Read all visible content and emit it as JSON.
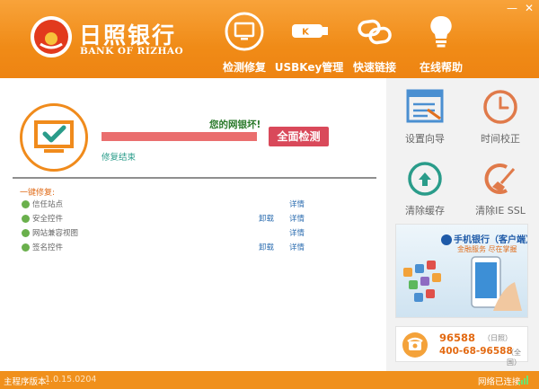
{
  "window": {
    "minimize": "—",
    "close": "✕"
  },
  "brand": {
    "name_cn": "日照银行",
    "name_en": "BANK OF RIZHAO"
  },
  "nav": [
    {
      "label": "检测修复",
      "icon": "monitor-check-icon"
    },
    {
      "label": "USBKey管理",
      "icon": "usbkey-icon"
    },
    {
      "label": "快速链接",
      "icon": "link-icon"
    },
    {
      "label": "在线帮助",
      "icon": "lightbulb-icon"
    }
  ],
  "scan": {
    "status_text": "您的网银坏!",
    "progress": 1.0,
    "button_label": "全面检测",
    "repair_done": "修复结束"
  },
  "repair": {
    "section_title": "一键修复:",
    "items": [
      {
        "label": "信任站点",
        "uninstall": "",
        "detail": "详情"
      },
      {
        "label": "安全控件",
        "uninstall": "卸载",
        "detail": "详情"
      },
      {
        "label": "网站兼容视图",
        "uninstall": "",
        "detail": "详情"
      },
      {
        "label": "签名控件",
        "uninstall": "卸载",
        "detail": "详情"
      }
    ]
  },
  "tools": [
    {
      "label": "设置向导",
      "icon": "settings-wizard-icon"
    },
    {
      "label": "时间校正",
      "icon": "clock-icon"
    },
    {
      "label": "清除缓存",
      "icon": "clear-cache-icon"
    },
    {
      "label": "清除IE SSL",
      "icon": "clear-ssl-broom-icon"
    }
  ],
  "ad": {
    "title": "手机银行（客户端）",
    "subtitle": "金融服务 尽在掌握"
  },
  "hotline": {
    "number1": "96588",
    "note1": "（日照）",
    "number2": "400-68-96588",
    "note2": "（全国）"
  },
  "status": {
    "version_label": "主程序版本:",
    "version_value": "1.0.15.0204",
    "network": "网络已连接"
  },
  "colors": {
    "header_orange": "#f08b17",
    "accent_teal": "#2a9c8a",
    "scan_button": "#d9495a",
    "progress_red": "#ea6e6e"
  }
}
